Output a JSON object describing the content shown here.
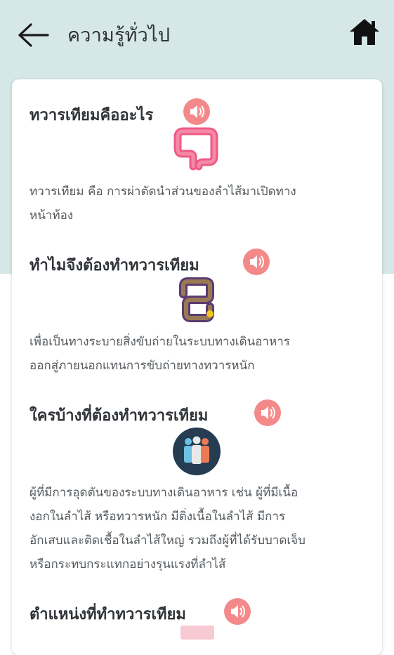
{
  "header": {
    "title": "ความรู้ทั่วไป",
    "back_icon": "arrow-left-icon",
    "home_icon": "home-icon"
  },
  "colors": {
    "header_bg": "#d6e7e8",
    "speaker": "#f4898a",
    "text_dark": "#303438",
    "text_body": "#555a5e"
  },
  "sections": [
    {
      "title": "ทวารเทียมคืออะไร",
      "icon": "large-intestine-pink-icon",
      "body_lines": [
        "ทวารเทียม คือ การผ่าตัดนำส่วนของลำไส้มาเปิดทาง",
        "หน้าท้อง"
      ]
    },
    {
      "title": "ทำไมจึงต้องทำทวารเทียม",
      "icon": "intestine-purple-icon",
      "body_lines": [
        "เพื่อเป็นทางระบายสิ่งขับถ่ายในระบบทางเดินอาหาร",
        "ออกสู่ภายนอกแทนการขับถ่ายทางทวารหนัก"
      ]
    },
    {
      "title": "ใครบ้างที่ต้องทำทวารเทียม",
      "icon": "people-group-icon",
      "body_lines": [
        "ผู้ที่มีการอุดตันของระบบทางเดินอาหาร เช่น ผู้ที่มีเนื้อ",
        "งอกในลำไส้ หรือทวารหนัก มีติ่งเนื้อในลำไส้ มีการ",
        "อักเสบและติดเชื้อในลำไส้ใหญ่ รวมถึงผู้ที่ได้รับบาดเจ็บ",
        "หรือกระทบกระแทกอย่างรุนแรงที่ลำไส้"
      ]
    },
    {
      "title": "ตำแหน่งที่ทำทวารเทียม",
      "icon": "body-position-icon",
      "body_lines": []
    }
  ]
}
